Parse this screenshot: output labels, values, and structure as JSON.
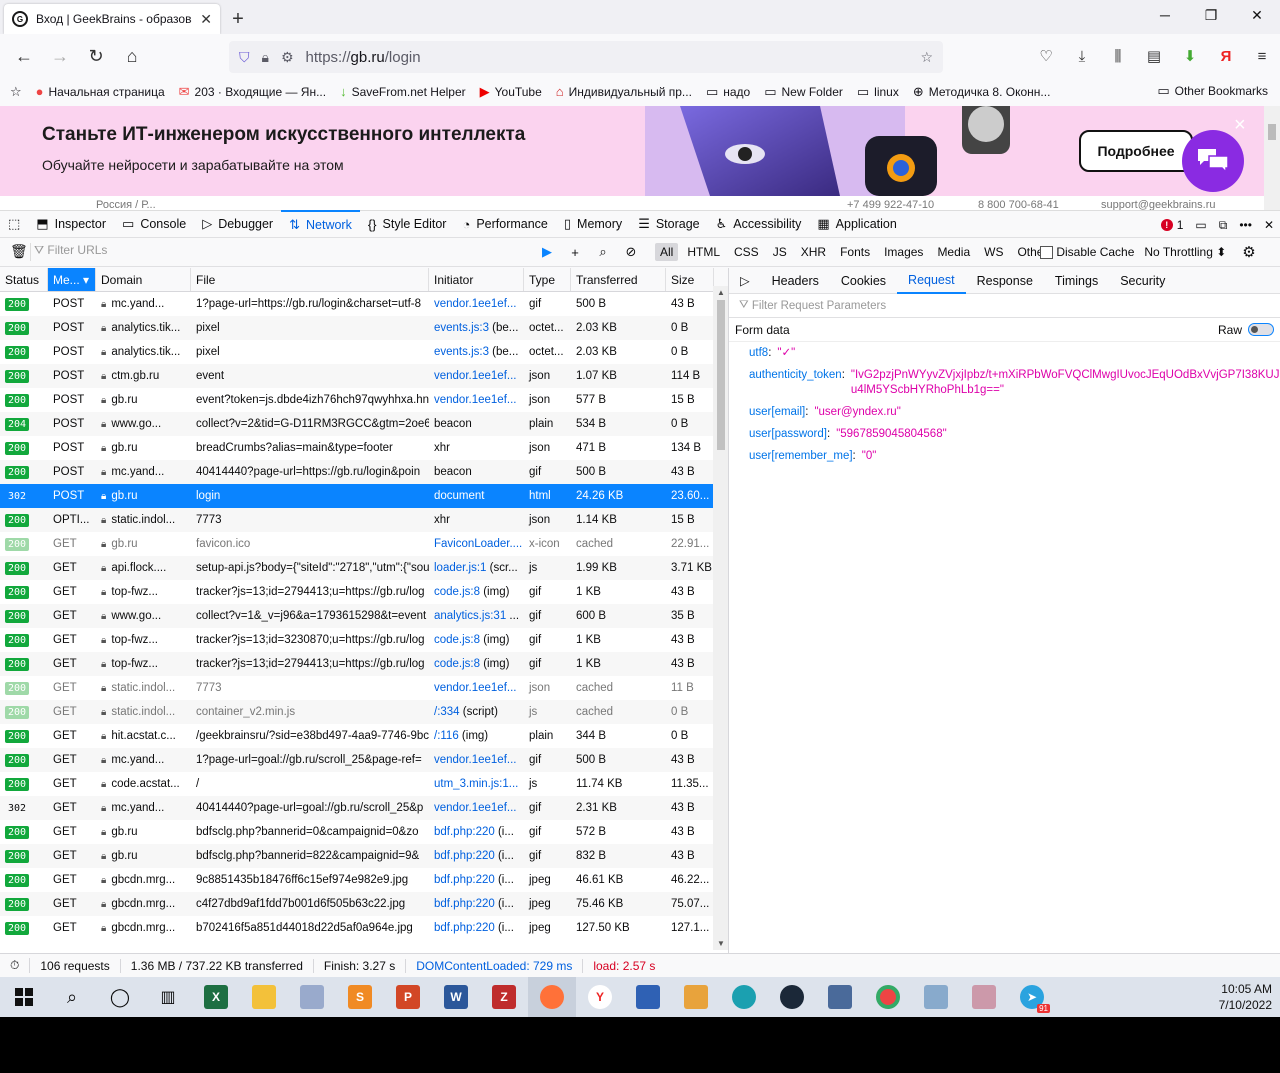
{
  "browser": {
    "tab_title": "Вход | GeekBrains - образоват",
    "new_tab": "+",
    "url_scheme": "https://",
    "url_host": "gb.ru",
    "url_path": "/login"
  },
  "bookmarks": [
    {
      "label": "Начальная страница",
      "icon": "●",
      "color": "#e44"
    },
    {
      "label": "203 · Входящие — Ян...",
      "icon": "✉",
      "color": "#e44"
    },
    {
      "label": "SaveFrom.net Helper",
      "icon": "↓",
      "color": "#5b3"
    },
    {
      "label": "YouTube",
      "icon": "▶",
      "color": "#e00"
    },
    {
      "label": "Индивидуальный пр...",
      "icon": "⌂",
      "color": "#c22"
    },
    {
      "label": "надо",
      "icon": "▭",
      "color": "#333"
    },
    {
      "label": "New Folder",
      "icon": "▭",
      "color": "#333"
    },
    {
      "label": "linux",
      "icon": "▭",
      "color": "#333"
    },
    {
      "label": "Методичка 8. Оконн...",
      "icon": "⊕",
      "color": "#333"
    }
  ],
  "other_bookmarks": "Other Bookmarks",
  "banner": {
    "title": "Станьте ИТ-инженером искусственного интеллекта",
    "subtitle": "Обучайте нейросети и зарабатывайте на этом",
    "button": "Подробнее",
    "close": "×",
    "strip_region": "Россия / Р...",
    "strip_phone1": "+7 499 922-47-10",
    "strip_phone2": "8 800 700-68-41",
    "strip_email": "support@geekbrains.ru"
  },
  "devtools": {
    "tabs": [
      "Inspector",
      "Console",
      "Debugger",
      "Network",
      "Style Editor",
      "Performance",
      "Memory",
      "Storage",
      "Accessibility",
      "Application"
    ],
    "error_count": "1",
    "filter_placeholder": "Filter URLs",
    "type_filters": [
      "All",
      "HTML",
      "CSS",
      "JS",
      "XHR",
      "Fonts",
      "Images",
      "Media",
      "WS",
      "Other"
    ],
    "disable_cache": "Disable Cache",
    "throttling": "No Throttling ⬍"
  },
  "table": {
    "columns": [
      "Status",
      "Me...",
      "Domain",
      "File",
      "Initiator",
      "Type",
      "Transferred",
      "Size"
    ],
    "rows": [
      {
        "status": "200",
        "method": "POST",
        "domain": "mc.yand...",
        "file": "1?page-url=https://gb.ru/login&charset=utf-8",
        "initiator": "vendor.1ee1ef...",
        "init_suffix": "",
        "type": "gif",
        "transferred": "500 B",
        "size": "43 B"
      },
      {
        "status": "200",
        "method": "POST",
        "domain": "analytics.tik...",
        "file": "pixel",
        "initiator": "events.js:3",
        "init_suffix": " (be...",
        "type": "octet...",
        "transferred": "2.03 KB",
        "size": "0 B"
      },
      {
        "status": "200",
        "method": "POST",
        "domain": "analytics.tik...",
        "file": "pixel",
        "initiator": "events.js:3",
        "init_suffix": " (be...",
        "type": "octet...",
        "transferred": "2.03 KB",
        "size": "0 B"
      },
      {
        "status": "200",
        "method": "POST",
        "domain": "ctm.gb.ru",
        "file": "event",
        "initiator": "vendor.1ee1ef...",
        "init_suffix": "",
        "type": "json",
        "transferred": "1.07 KB",
        "size": "114 B"
      },
      {
        "status": "200",
        "method": "POST",
        "domain": "gb.ru",
        "file": "event?token=js.dbde4izh76hch97qwyhhxa.hn",
        "initiator": "vendor.1ee1ef...",
        "init_suffix": "",
        "type": "json",
        "transferred": "577 B",
        "size": "15 B"
      },
      {
        "status": "204",
        "method": "POST",
        "domain": "www.go...",
        "file": "collect?v=2&tid=G-D11RM3RGCC&gtm=2oe6",
        "initiator": "",
        "init_suffix": "beacon",
        "type": "plain",
        "transferred": "534 B",
        "size": "0 B"
      },
      {
        "status": "200",
        "method": "POST",
        "domain": "gb.ru",
        "file": "breadCrumbs?alias=main&type=footer",
        "initiator": "",
        "init_suffix": "xhr",
        "type": "json",
        "transferred": "471 B",
        "size": "134 B"
      },
      {
        "status": "200",
        "method": "POST",
        "domain": "mc.yand...",
        "file": "40414440?page-url=https://gb.ru/login&poin",
        "initiator": "",
        "init_suffix": "beacon",
        "type": "gif",
        "transferred": "500 B",
        "size": "43 B"
      },
      {
        "status": "302",
        "method": "POST",
        "domain": "gb.ru",
        "file": "login",
        "initiator": "",
        "init_suffix": "document",
        "type": "html",
        "transferred": "24.26 KB",
        "size": "23.60..."
      },
      {
        "status": "200",
        "method": "OPTI...",
        "domain": "static.indol...",
        "file": "7773",
        "initiator": "",
        "init_suffix": "xhr",
        "type": "json",
        "transferred": "1.14 KB",
        "size": "15 B"
      },
      {
        "status": "200",
        "method": "GET",
        "domain": "gb.ru",
        "file": "favicon.ico",
        "initiator": "FaviconLoader....",
        "init_suffix": "",
        "type": "x-icon",
        "transferred": "cached",
        "size": "22.91..."
      },
      {
        "status": "200",
        "method": "GET",
        "domain": "api.flock....",
        "file": "setup-api.js?body={\"siteId\":\"2718\",\"utm\":{\"sou",
        "initiator": "loader.js:1",
        "init_suffix": " (scr...",
        "type": "js",
        "transferred": "1.99 KB",
        "size": "3.71 KB"
      },
      {
        "status": "200",
        "method": "GET",
        "domain": "top-fwz...",
        "file": "tracker?js=13;id=2794413;u=https://gb.ru/log",
        "initiator": "code.js:8",
        "init_suffix": " (img)",
        "type": "gif",
        "transferred": "1 KB",
        "size": "43 B"
      },
      {
        "status": "200",
        "method": "GET",
        "domain": "www.go...",
        "file": "collect?v=1&_v=j96&a=1793615298&t=event",
        "initiator": "analytics.js:31",
        "init_suffix": " ...",
        "type": "gif",
        "transferred": "600 B",
        "size": "35 B"
      },
      {
        "status": "200",
        "method": "GET",
        "domain": "top-fwz...",
        "file": "tracker?js=13;id=3230870;u=https://gb.ru/log",
        "initiator": "code.js:8",
        "init_suffix": " (img)",
        "type": "gif",
        "transferred": "1 KB",
        "size": "43 B"
      },
      {
        "status": "200",
        "method": "GET",
        "domain": "top-fwz...",
        "file": "tracker?js=13;id=2794413;u=https://gb.ru/log",
        "initiator": "code.js:8",
        "init_suffix": " (img)",
        "type": "gif",
        "transferred": "1 KB",
        "size": "43 B"
      },
      {
        "status": "200",
        "method": "GET",
        "domain": "static.indol...",
        "file": "7773",
        "initiator": "vendor.1ee1ef...",
        "init_suffix": "",
        "type": "json",
        "transferred": "cached",
        "size": "11 B"
      },
      {
        "status": "200",
        "method": "GET",
        "domain": "static.indol...",
        "file": "container_v2.min.js",
        "initiator": "/:334",
        "init_suffix": " (script)",
        "type": "js",
        "transferred": "cached",
        "size": "0 B"
      },
      {
        "status": "200",
        "method": "GET",
        "domain": "hit.acstat.c...",
        "file": "/geekbrainsru/?sid=e38bd497-4aa9-7746-9bc",
        "initiator": "/:116",
        "init_suffix": " (img)",
        "type": "plain",
        "transferred": "344 B",
        "size": "0 B"
      },
      {
        "status": "200",
        "method": "GET",
        "domain": "mc.yand...",
        "file": "1?page-url=goal://gb.ru/scroll_25&page-ref=",
        "initiator": "vendor.1ee1ef...",
        "init_suffix": "",
        "type": "gif",
        "transferred": "500 B",
        "size": "43 B"
      },
      {
        "status": "200",
        "method": "GET",
        "domain": "code.acstat...",
        "file": "/",
        "initiator": "utm_3.min.js:1...",
        "init_suffix": "",
        "type": "js",
        "transferred": "11.74 KB",
        "size": "11.35..."
      },
      {
        "status": "302",
        "method": "GET",
        "domain": "mc.yand...",
        "file": "40414440?page-url=goal://gb.ru/scroll_25&p",
        "initiator": "vendor.1ee1ef...",
        "init_suffix": "",
        "type": "gif",
        "transferred": "2.31 KB",
        "size": "43 B"
      },
      {
        "status": "200",
        "method": "GET",
        "domain": "gb.ru",
        "file": "bdfsclg.php?bannerid=0&campaignid=0&zo",
        "initiator": "bdf.php:220",
        "init_suffix": " (i...",
        "type": "gif",
        "transferred": "572 B",
        "size": "43 B"
      },
      {
        "status": "200",
        "method": "GET",
        "domain": "gb.ru",
        "file": "bdfsclg.php?bannerid=822&campaignid=9&",
        "initiator": "bdf.php:220",
        "init_suffix": " (i...",
        "type": "gif",
        "transferred": "832 B",
        "size": "43 B"
      },
      {
        "status": "200",
        "method": "GET",
        "domain": "gbcdn.mrg...",
        "file": "9c8851435b18476ff6c15ef974e982e9.jpg",
        "initiator": "bdf.php:220",
        "init_suffix": " (i...",
        "type": "jpeg",
        "transferred": "46.61 KB",
        "size": "46.22..."
      },
      {
        "status": "200",
        "method": "GET",
        "domain": "gbcdn.mrg...",
        "file": "c4f27dbd9af1fdd7b001d6f505b63c22.jpg",
        "initiator": "bdf.php:220",
        "init_suffix": " (i...",
        "type": "jpeg",
        "transferred": "75.46 KB",
        "size": "75.07..."
      },
      {
        "status": "200",
        "method": "GET",
        "domain": "gbcdn.mrg...",
        "file": "b702416f5a851d44018d22d5af0a964e.jpg",
        "initiator": "bdf.php:220",
        "init_suffix": " (i...",
        "type": "jpeg",
        "transferred": "127.50 KB",
        "size": "127.1..."
      }
    ]
  },
  "side_panel": {
    "tabs": [
      "Headers",
      "Cookies",
      "Request",
      "Response",
      "Timings",
      "Security"
    ],
    "filter_placeholder": "Filter Request Parameters",
    "section": "Form data",
    "raw_label": "Raw",
    "params": [
      {
        "key": "utf8",
        "value": "\"✓\""
      },
      {
        "key": "authenticity_token",
        "value": "\"IvG2pzjPnWYyvZVjxjIpbz/t+mXiRPbWoFVQClMwgIUvocJEqUOdBxVvjGP7I38KUJu4lM5YScbHYRhoPhLb1g==\""
      },
      {
        "key": "user[email]",
        "value": "\"user@yndex.ru\""
      },
      {
        "key": "user[password]",
        "value": "\"5967859045804568\""
      },
      {
        "key": "user[remember_me]",
        "value": "\"0\""
      }
    ]
  },
  "statusbar": {
    "requests": "106 requests",
    "transferred": "1.36 MB / 737.22 KB transferred",
    "finish": "Finish: 3.27 s",
    "dom": "DOMContentLoaded: 729 ms",
    "load": "load: 2.57 s"
  },
  "clock": {
    "time": "10:05 AM",
    "date": "7/10/2022"
  },
  "taskbar_badge": "91"
}
